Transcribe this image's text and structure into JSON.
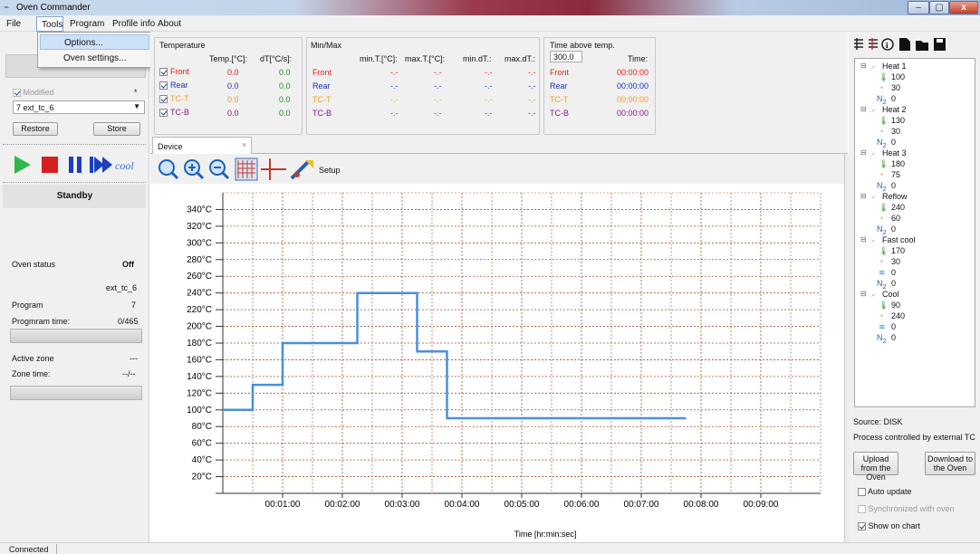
{
  "app": {
    "title": "Oven Commander",
    "win_min": "‒",
    "win_max": "▢",
    "win_close": "x"
  },
  "menu": {
    "file": "File",
    "tools": "Tools",
    "program": "Program",
    "profile_info": "Profile info",
    "about": "About"
  },
  "tools_menu": {
    "options": "Options...",
    "oven_settings": "Oven settings..."
  },
  "left": {
    "modified_label": "Modified",
    "modified_marker": "*",
    "profile_selected": "7 ext_tc_6",
    "restore": "Restore",
    "store": "Store",
    "status_mode": "Standby",
    "oven_status_label": "Oven status",
    "oven_status_value": "Off",
    "profile_name": "ext_tc_6",
    "program_label": "Program",
    "program_value": "7",
    "program_time_label": "Progmram time:",
    "program_time_value": "0/465",
    "active_zone_label": "Active zone",
    "active_zone_value": "---",
    "zone_time_label": "Zone time:",
    "zone_time_value": "--/--"
  },
  "toolbar_icons": {
    "play": "play-icon",
    "stop": "stop-icon",
    "pause": "pause-icon",
    "next": "skip-icon",
    "cool": "cool"
  },
  "temperature": {
    "title": "Temperature",
    "col_temp": "Temp.[°C]:",
    "col_dt": "dT[°C/s]:",
    "rows": [
      {
        "name": "Front",
        "temp": "0.0",
        "dt": "0.0",
        "color": "#e02020"
      },
      {
        "name": "Rear",
        "temp": "0.0",
        "dt": "0.0",
        "color": "#1a2fbf"
      },
      {
        "name": "TC-T",
        "temp": "0.0",
        "dt": "0.0",
        "color": "#f0a020"
      },
      {
        "name": "TC-B",
        "temp": "0.0",
        "dt": "0.0",
        "color": "#8b1a8b"
      }
    ]
  },
  "minmax": {
    "title": "Min/Max",
    "col_min_t": "min.T.[°C]:",
    "col_max_t": "max.T.[°C]:",
    "col_min_dt": "min.dT.:",
    "col_max_dt": "max.dT.:",
    "rows": [
      {
        "name": "Front",
        "v": [
          "-.-",
          "-.-",
          "-.-",
          "-.-"
        ]
      },
      {
        "name": "Rear",
        "v": [
          "-.-",
          "-.-",
          "-.-",
          "-.-"
        ]
      },
      {
        "name": "TC-T",
        "v": [
          "-.-",
          "-.-",
          "-.-",
          "-.-"
        ]
      },
      {
        "name": "TC-B",
        "v": [
          "-.-",
          "-.-",
          "-.-",
          "-.-"
        ]
      }
    ]
  },
  "time_above": {
    "title": "Time above temp.",
    "threshold": "300.0",
    "col_time": "Time:",
    "rows": [
      {
        "name": "Front",
        "time": "00:00:00"
      },
      {
        "name": "Rear",
        "time": "00:00:00"
      },
      {
        "name": "TC-T",
        "time": "00:00:00"
      },
      {
        "name": "TC-B",
        "time": "00:00:00"
      }
    ]
  },
  "device_tab": {
    "label": "Device",
    "close": "×",
    "setup": "Setup"
  },
  "chart_data": {
    "type": "line",
    "xlabel": "Time [hr:min:sec]",
    "ylabel": "",
    "x_ticks": [
      "00:01:00",
      "00:02:00",
      "00:03:00",
      "00:04:00",
      "00:05:00",
      "00:06:00",
      "00:07:00",
      "00:08:00",
      "00:09:00"
    ],
    "y_ticks": [
      "20°C",
      "40°C",
      "60°C",
      "80°C",
      "100°C",
      "120°C",
      "140°C",
      "160°C",
      "180°C",
      "200°C",
      "220°C",
      "240°C",
      "260°C",
      "280°C",
      "300°C",
      "320°C",
      "340°C"
    ],
    "xlim": [
      0,
      600
    ],
    "ylim": [
      0,
      360
    ],
    "grid": true,
    "series": [
      {
        "color": "#4a90d9",
        "points": [
          [
            0,
            100
          ],
          [
            30,
            100
          ],
          [
            30,
            130
          ],
          [
            60,
            130
          ],
          [
            60,
            180
          ],
          [
            135,
            180
          ],
          [
            135,
            240
          ],
          [
            195,
            240
          ],
          [
            195,
            170
          ],
          [
            225,
            170
          ],
          [
            225,
            90
          ],
          [
            465,
            90
          ]
        ]
      }
    ]
  },
  "tree": {
    "toolbar_icons": [
      "expand-icon",
      "collapse-icon",
      "info-icon",
      "new-icon",
      "open-icon",
      "save-icon"
    ],
    "zones": [
      {
        "name": "Heat 1",
        "temp": "100",
        "time": "30",
        "fan": null,
        "n2": "0"
      },
      {
        "name": "Heat 2",
        "temp": "130",
        "time": "30",
        "fan": null,
        "n2": "0"
      },
      {
        "name": "Heat 3",
        "temp": "180",
        "time": "75",
        "fan": null,
        "n2": "0"
      },
      {
        "name": "Reflow",
        "temp": "240",
        "time": "60",
        "fan": null,
        "n2": "0"
      },
      {
        "name": "Fast cool",
        "temp": "170",
        "time": "30",
        "fan": "0",
        "n2": "0"
      },
      {
        "name": "Cool",
        "temp": "90",
        "time": "240",
        "fan": "0",
        "n2": "0"
      }
    ]
  },
  "right": {
    "source": "Source: DISK",
    "process": "Process controlled by external TC",
    "upload": "Upload from the Oven",
    "download": "Download to the Oven",
    "auto_update": "Auto update",
    "sync": "Synchronized with oven",
    "show_chart": "Show on chart"
  },
  "statusbar": {
    "connection": "Connected"
  }
}
